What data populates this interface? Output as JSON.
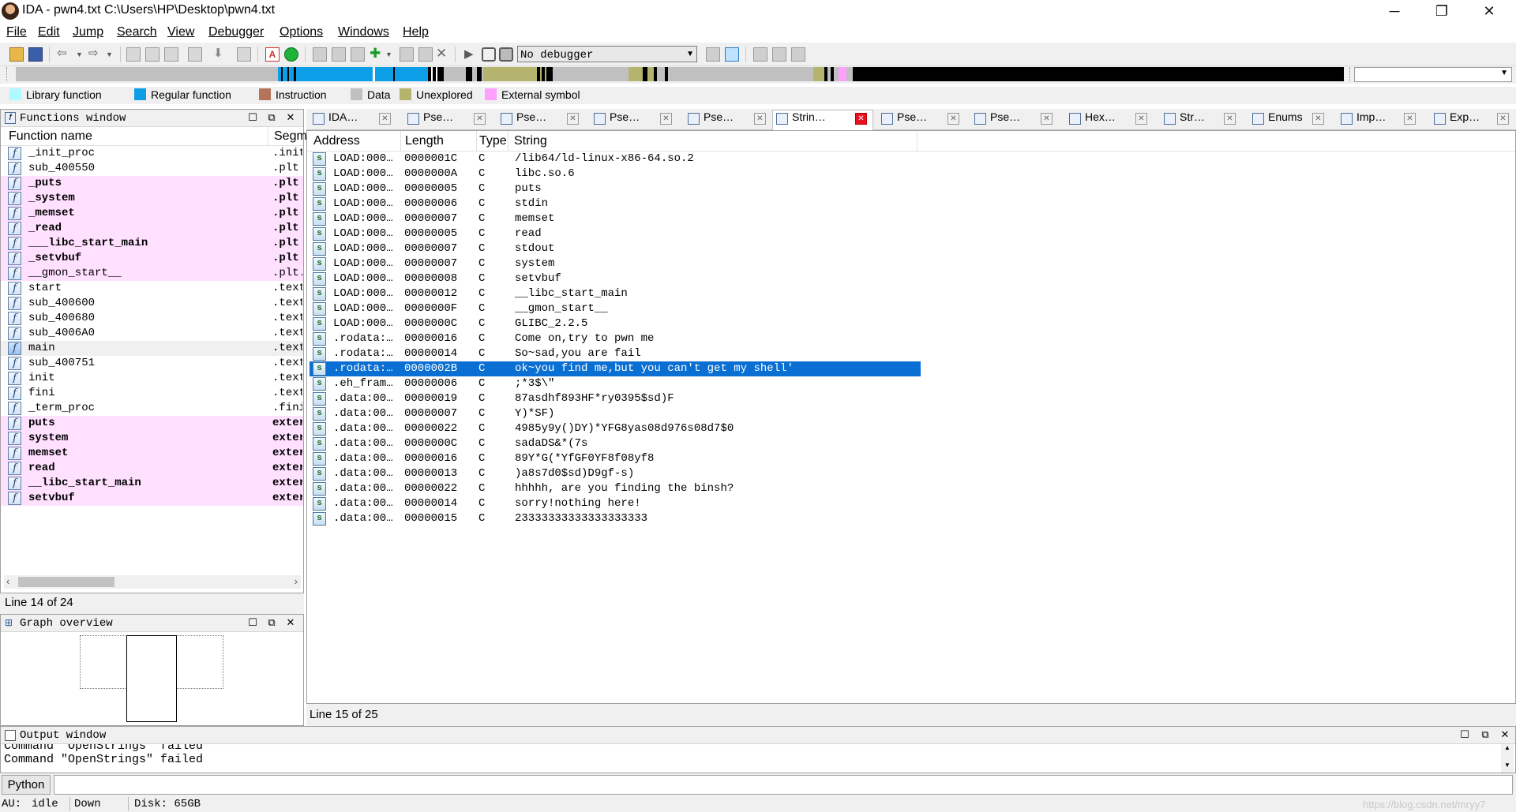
{
  "app": {
    "title": "IDA - pwn4.txt C:\\Users\\HP\\Desktop\\pwn4.txt",
    "min_glyph": "─",
    "restore_glyph": "❐",
    "close_glyph": "✕"
  },
  "menu": [
    "File",
    "Edit",
    "Jump",
    "Search",
    "View",
    "Debugger",
    "Options",
    "Windows",
    "Help"
  ],
  "toolbar": {
    "debugger_select": "No debugger"
  },
  "legend": [
    {
      "label": "Library function",
      "color": "#aefaff"
    },
    {
      "label": "Regular function",
      "color": "#0c9ee6"
    },
    {
      "label": "Instruction",
      "color": "#b4735a"
    },
    {
      "label": "Data",
      "color": "#c0c0c0"
    },
    {
      "label": "Unexplored",
      "color": "#b4b46e"
    },
    {
      "label": "External symbol",
      "color": "#ffa0ff"
    }
  ],
  "functions": {
    "title": "Functions window",
    "col_name": "Function name",
    "col_segment": "Segm",
    "status": "Line 14 of 24",
    "rows": [
      {
        "name": "_init_proc",
        "segment": ".init",
        "pink": false,
        "bold": false,
        "selected": false
      },
      {
        "name": "sub_400550",
        "segment": ".plt",
        "pink": false,
        "bold": false,
        "selected": false
      },
      {
        "name": "_puts",
        "segment": ".plt",
        "pink": true,
        "bold": true,
        "selected": false
      },
      {
        "name": "_system",
        "segment": ".plt",
        "pink": true,
        "bold": true,
        "selected": false
      },
      {
        "name": "_memset",
        "segment": ".plt",
        "pink": true,
        "bold": true,
        "selected": false
      },
      {
        "name": "_read",
        "segment": ".plt",
        "pink": true,
        "bold": true,
        "selected": false
      },
      {
        "name": "___libc_start_main",
        "segment": ".plt",
        "pink": true,
        "bold": true,
        "selected": false
      },
      {
        "name": "_setvbuf",
        "segment": ".plt",
        "pink": true,
        "bold": true,
        "selected": false
      },
      {
        "name": "__gmon_start__",
        "segment": ".plt.",
        "pink": true,
        "bold": false,
        "selected": false
      },
      {
        "name": "start",
        "segment": ".text",
        "pink": false,
        "bold": false,
        "selected": false
      },
      {
        "name": "sub_400600",
        "segment": ".text",
        "pink": false,
        "bold": false,
        "selected": false
      },
      {
        "name": "sub_400680",
        "segment": ".text",
        "pink": false,
        "bold": false,
        "selected": false
      },
      {
        "name": "sub_4006A0",
        "segment": ".text",
        "pink": false,
        "bold": false,
        "selected": false
      },
      {
        "name": "main",
        "segment": ".text",
        "pink": false,
        "bold": false,
        "selected": true
      },
      {
        "name": "sub_400751",
        "segment": ".text",
        "pink": false,
        "bold": false,
        "selected": false
      },
      {
        "name": "init",
        "segment": ".text",
        "pink": false,
        "bold": false,
        "selected": false
      },
      {
        "name": "fini",
        "segment": ".text",
        "pink": false,
        "bold": false,
        "selected": false
      },
      {
        "name": "_term_proc",
        "segment": ".fini",
        "pink": false,
        "bold": false,
        "selected": false
      },
      {
        "name": "puts",
        "segment": "exter",
        "pink": true,
        "bold": true,
        "selected": false
      },
      {
        "name": "system",
        "segment": "exter",
        "pink": true,
        "bold": true,
        "selected": false
      },
      {
        "name": "memset",
        "segment": "exter",
        "pink": true,
        "bold": true,
        "selected": false
      },
      {
        "name": "read",
        "segment": "exter",
        "pink": true,
        "bold": true,
        "selected": false
      },
      {
        "name": "__libc_start_main",
        "segment": "exter",
        "pink": true,
        "bold": true,
        "selected": false
      },
      {
        "name": "setvbuf",
        "segment": "exter",
        "pink": true,
        "bold": true,
        "selected": false
      }
    ]
  },
  "graph": {
    "title": "Graph overview"
  },
  "tabs": [
    {
      "label": "IDA…",
      "icon": "ida-view-icon",
      "active": false
    },
    {
      "label": "Pse…",
      "icon": "pseudocode-icon",
      "active": false
    },
    {
      "label": "Pse…",
      "icon": "pseudocode-icon",
      "active": false
    },
    {
      "label": "Pse…",
      "icon": "pseudocode-icon",
      "active": false
    },
    {
      "label": "Pse…",
      "icon": "pseudocode-icon",
      "active": false
    },
    {
      "label": "Strin…",
      "icon": "strings-icon",
      "active": true
    },
    {
      "label": "Pse…",
      "icon": "pseudocode-icon",
      "active": false
    },
    {
      "label": "Pse…",
      "icon": "pseudocode-icon",
      "active": false
    },
    {
      "label": "Hex…",
      "icon": "hex-view-icon",
      "active": false
    },
    {
      "label": "Str…",
      "icon": "structures-icon",
      "active": false
    },
    {
      "label": "Enums",
      "icon": "enums-icon",
      "active": false
    },
    {
      "label": "Imp…",
      "icon": "imports-icon",
      "active": false
    },
    {
      "label": "Exp…",
      "icon": "exports-icon",
      "active": false
    }
  ],
  "strings": {
    "cols": [
      "Address",
      "Length",
      "Type",
      "String"
    ],
    "status": "Line 15 of 25",
    "rows": [
      {
        "address": "LOAD:000…",
        "length": "0000001C",
        "type": "C",
        "string": "/lib64/ld-linux-x86-64.so.2",
        "selected": false
      },
      {
        "address": "LOAD:000…",
        "length": "0000000A",
        "type": "C",
        "string": "libc.so.6",
        "selected": false
      },
      {
        "address": "LOAD:000…",
        "length": "00000005",
        "type": "C",
        "string": "puts",
        "selected": false
      },
      {
        "address": "LOAD:000…",
        "length": "00000006",
        "type": "C",
        "string": "stdin",
        "selected": false
      },
      {
        "address": "LOAD:000…",
        "length": "00000007",
        "type": "C",
        "string": "memset",
        "selected": false
      },
      {
        "address": "LOAD:000…",
        "length": "00000005",
        "type": "C",
        "string": "read",
        "selected": false
      },
      {
        "address": "LOAD:000…",
        "length": "00000007",
        "type": "C",
        "string": "stdout",
        "selected": false
      },
      {
        "address": "LOAD:000…",
        "length": "00000007",
        "type": "C",
        "string": "system",
        "selected": false
      },
      {
        "address": "LOAD:000…",
        "length": "00000008",
        "type": "C",
        "string": "setvbuf",
        "selected": false
      },
      {
        "address": "LOAD:000…",
        "length": "00000012",
        "type": "C",
        "string": "__libc_start_main",
        "selected": false
      },
      {
        "address": "LOAD:000…",
        "length": "0000000F",
        "type": "C",
        "string": "__gmon_start__",
        "selected": false
      },
      {
        "address": "LOAD:000…",
        "length": "0000000C",
        "type": "C",
        "string": "GLIBC_2.2.5",
        "selected": false
      },
      {
        "address": ".rodata:…",
        "length": "00000016",
        "type": "C",
        "string": "Come on,try to pwn me",
        "selected": false
      },
      {
        "address": ".rodata:…",
        "length": "00000014",
        "type": "C",
        "string": "So~sad,you are fail",
        "selected": false
      },
      {
        "address": ".rodata:…",
        "length": "0000002B",
        "type": "C",
        "string": "ok~you find me,but you can't get my shell'",
        "selected": true
      },
      {
        "address": ".eh_fram…",
        "length": "00000006",
        "type": "C",
        "string": ";*3$\\\"",
        "selected": false
      },
      {
        "address": ".data:00…",
        "length": "00000019",
        "type": "C",
        "string": "87asdhf893HF*ry0395$sd)F",
        "selected": false
      },
      {
        "address": ".data:00…",
        "length": "00000007",
        "type": "C",
        "string": "Y)*SF)",
        "selected": false
      },
      {
        "address": ".data:00…",
        "length": "00000022",
        "type": "C",
        "string": "4985y9y()DY)*YFG8yas08d976s08d7$0",
        "selected": false
      },
      {
        "address": ".data:00…",
        "length": "0000000C",
        "type": "C",
        "string": "sadaDS&*(7s",
        "selected": false
      },
      {
        "address": ".data:00…",
        "length": "00000016",
        "type": "C",
        "string": "89Y*G(*YfGF0YF8f08yf8",
        "selected": false
      },
      {
        "address": ".data:00…",
        "length": "00000013",
        "type": "C",
        "string": ")a8s7d0$sd)D9gf-s)",
        "selected": false
      },
      {
        "address": ".data:00…",
        "length": "00000022",
        "type": "C",
        "string": "hhhhh, are you finding the binsh?",
        "selected": false
      },
      {
        "address": ".data:00…",
        "length": "00000014",
        "type": "C",
        "string": "sorry!nothing here!",
        "selected": false
      },
      {
        "address": ".data:00…",
        "length": "00000015",
        "type": "C",
        "string": "23333333333333333333",
        "selected": false
      }
    ]
  },
  "output": {
    "title": "Output window",
    "lines": [
      "Command \"OpenStrings\" failed",
      "Command \"OpenStrings\" failed"
    ],
    "python_button": "Python"
  },
  "statusbar": {
    "au_label": "AU:",
    "au_value": "idle",
    "direction": "Down",
    "disk": "Disk: 65GB",
    "watermark": "https://blog.csdn.net/mryy7"
  }
}
